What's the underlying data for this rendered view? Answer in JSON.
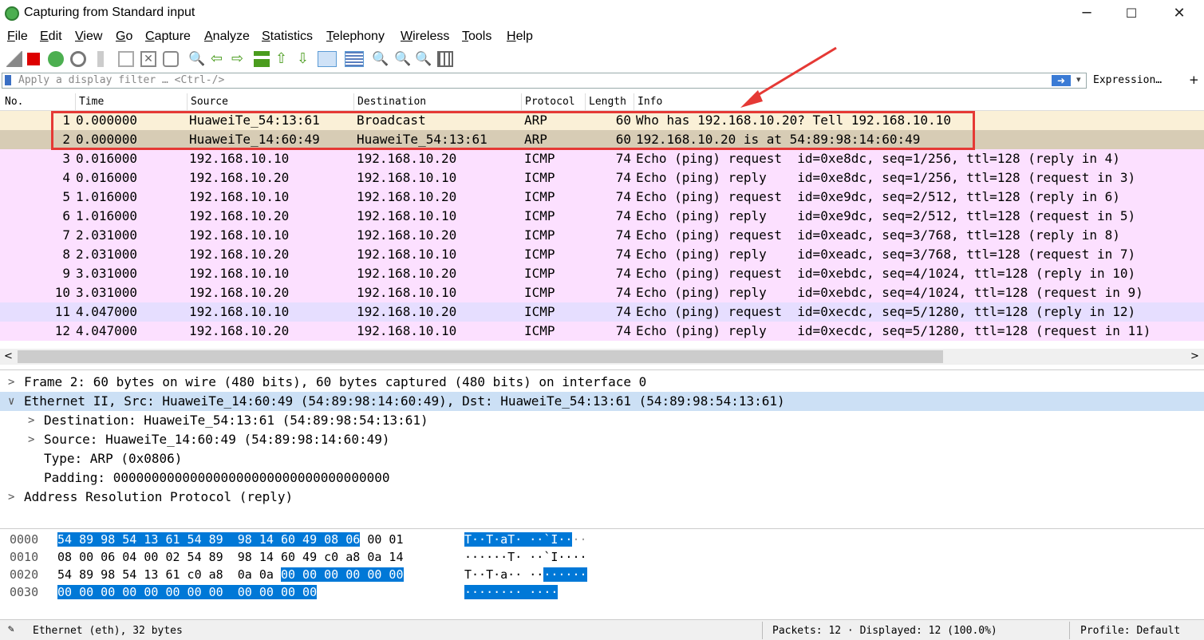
{
  "window": {
    "title": "Capturing from Standard input",
    "minimize": "─",
    "maximize": "☐",
    "close": "✕"
  },
  "menu": [
    "File",
    "Edit",
    "View",
    "Go",
    "Capture",
    "Analyze",
    "Statistics",
    "Telephony",
    "Wireless",
    "Tools",
    "Help"
  ],
  "filter": {
    "placeholder": "Apply a display filter … <Ctrl-/>",
    "expression_label": "Expression…",
    "plus": "+"
  },
  "columns": {
    "no": "No.",
    "time": "Time",
    "source": "Source",
    "destination": "Destination",
    "protocol": "Protocol",
    "length": "Length",
    "info": "Info"
  },
  "packets": [
    {
      "no": "1",
      "time": "0.000000",
      "src": "HuaweiTe_54:13:61",
      "dst": "Broadcast",
      "proto": "ARP",
      "len": "60",
      "info": "Who has 192.168.10.20? Tell 192.168.10.10"
    },
    {
      "no": "2",
      "time": "0.000000",
      "src": "HuaweiTe_14:60:49",
      "dst": "HuaweiTe_54:13:61",
      "proto": "ARP",
      "len": "60",
      "info": "192.168.10.20 is at 54:89:98:14:60:49"
    },
    {
      "no": "3",
      "time": "0.016000",
      "src": "192.168.10.10",
      "dst": "192.168.10.20",
      "proto": "ICMP",
      "len": "74",
      "info": "Echo (ping) request  id=0xe8dc, seq=1/256, ttl=128 (reply in 4)"
    },
    {
      "no": "4",
      "time": "0.016000",
      "src": "192.168.10.20",
      "dst": "192.168.10.10",
      "proto": "ICMP",
      "len": "74",
      "info": "Echo (ping) reply    id=0xe8dc, seq=1/256, ttl=128 (request in 3)"
    },
    {
      "no": "5",
      "time": "1.016000",
      "src": "192.168.10.10",
      "dst": "192.168.10.20",
      "proto": "ICMP",
      "len": "74",
      "info": "Echo (ping) request  id=0xe9dc, seq=2/512, ttl=128 (reply in 6)"
    },
    {
      "no": "6",
      "time": "1.016000",
      "src": "192.168.10.20",
      "dst": "192.168.10.10",
      "proto": "ICMP",
      "len": "74",
      "info": "Echo (ping) reply    id=0xe9dc, seq=2/512, ttl=128 (request in 5)"
    },
    {
      "no": "7",
      "time": "2.031000",
      "src": "192.168.10.10",
      "dst": "192.168.10.20",
      "proto": "ICMP",
      "len": "74",
      "info": "Echo (ping) request  id=0xeadc, seq=3/768, ttl=128 (reply in 8)"
    },
    {
      "no": "8",
      "time": "2.031000",
      "src": "192.168.10.20",
      "dst": "192.168.10.10",
      "proto": "ICMP",
      "len": "74",
      "info": "Echo (ping) reply    id=0xeadc, seq=3/768, ttl=128 (request in 7)"
    },
    {
      "no": "9",
      "time": "3.031000",
      "src": "192.168.10.10",
      "dst": "192.168.10.20",
      "proto": "ICMP",
      "len": "74",
      "info": "Echo (ping) request  id=0xebdc, seq=4/1024, ttl=128 (reply in 10)"
    },
    {
      "no": "10",
      "time": "3.031000",
      "src": "192.168.10.20",
      "dst": "192.168.10.10",
      "proto": "ICMP",
      "len": "74",
      "info": "Echo (ping) reply    id=0xebdc, seq=4/1024, ttl=128 (request in 9)"
    },
    {
      "no": "11",
      "time": "4.047000",
      "src": "192.168.10.10",
      "dst": "192.168.10.20",
      "proto": "ICMP",
      "len": "74",
      "info": "Echo (ping) request  id=0xecdc, seq=5/1280, ttl=128 (reply in 12)"
    },
    {
      "no": "12",
      "time": "4.047000",
      "src": "192.168.10.20",
      "dst": "192.168.10.10",
      "proto": "ICMP",
      "len": "74",
      "info": "Echo (ping) reply    id=0xecdc, seq=5/1280, ttl=128 (request in 11)"
    }
  ],
  "colors": {
    "arp_row": "#faf0d7",
    "icmp_row": "#fce0ff",
    "selected_row": "#d7ccb5",
    "alt_row": "#e6deff",
    "highlight": "#0078d7",
    "annotation": "#e53935"
  },
  "details": [
    {
      "text": "Frame 2: 60 bytes on wire (480 bits), 60 bytes captured (480 bits) on interface 0",
      "arrow": ">"
    },
    {
      "text": "Ethernet II, Src: HuaweiTe_14:60:49 (54:89:98:14:60:49), Dst: HuaweiTe_54:13:61 (54:89:98:54:13:61)",
      "arrow": "∨"
    },
    {
      "text": "Destination: HuaweiTe_54:13:61 (54:89:98:54:13:61)",
      "arrow": ">"
    },
    {
      "text": "Source: HuaweiTe_14:60:49 (54:89:98:14:60:49)",
      "arrow": ">"
    },
    {
      "text": "Type: ARP (0x0806)",
      "arrow": ""
    },
    {
      "text": "Padding: 000000000000000000000000000000000000",
      "arrow": ""
    },
    {
      "text": "Address Resolution Protocol (reply)",
      "arrow": ">"
    }
  ],
  "bytes": [
    {
      "offset": "0000",
      "hex_hl": "54 89 98 54 13 61 54 89  98 14 60 49 08 06",
      "hex_rest": " 00 01",
      "ascii_hl": "T··T·aT· ··`I··",
      "ascii_rest": "··"
    },
    {
      "offset": "0010",
      "hex_pre": "08 00 06 04 00 02 54 89  98 14 60 49 c0 a8 0a 14",
      "ascii_pre": "······T· ··`I····"
    },
    {
      "offset": "0020",
      "hex_pre": "54 89 98 54 13 61 c0 a8  0a 0a ",
      "hex_hl": "00 00 00 00 00 00",
      "ascii_pre": "T··T·a·· ··",
      "ascii_hl": "······"
    },
    {
      "offset": "0030",
      "hex_hl": "00 00 00 00 00 00 00 00  00 00 00 00",
      "ascii_hl": "········ ····"
    }
  ],
  "status": {
    "left": "Ethernet (eth), 32 bytes",
    "packets": "Packets: 12 · Displayed: 12 (100.0%)",
    "profile": "Profile: Default"
  }
}
